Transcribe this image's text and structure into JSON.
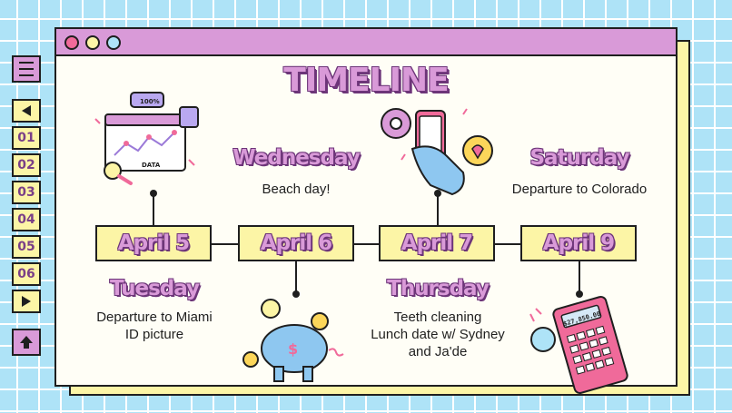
{
  "title": "TIMELINE",
  "window_controls": [
    "close-dot",
    "minimize-dot",
    "maximize-dot"
  ],
  "sidebar": {
    "menu_icon": "hamburger-icon",
    "prev_icon": "arrow-left-icon",
    "pages": [
      "01",
      "02",
      "03",
      "04",
      "05",
      "06"
    ],
    "next_icon": "arrow-right-icon",
    "home_icon": "arrow-up-icon"
  },
  "events": [
    {
      "date": "April 5",
      "day": "Tuesday",
      "lines": [
        "Departure to Miami",
        "ID picture"
      ],
      "position": "below"
    },
    {
      "date": "April 6",
      "day": "Wednesday",
      "lines": [
        "Beach day!"
      ],
      "position": "above"
    },
    {
      "date": "April 7",
      "day": "Thursday",
      "lines": [
        "Teeth cleaning",
        "Lunch date w/ Sydney",
        "and Ja'de"
      ],
      "position": "below"
    },
    {
      "date": "April 9",
      "day": "Saturday",
      "lines": [
        "Departure to Colorado"
      ],
      "position": "above"
    }
  ],
  "illustrations": [
    "data-chart-illustration",
    "phone-chat-illustration",
    "piggy-bank-illustration",
    "calculator-illustration"
  ],
  "calculator_display": "$27,850.00",
  "chart_label": "DATA",
  "chart_percent": "100%",
  "colors": {
    "pink": "#d99ad8",
    "yellow": "#fcf5a6",
    "blue": "#aee3f7",
    "outline": "#1f1f1f",
    "title_shadow": "#6d3579"
  }
}
